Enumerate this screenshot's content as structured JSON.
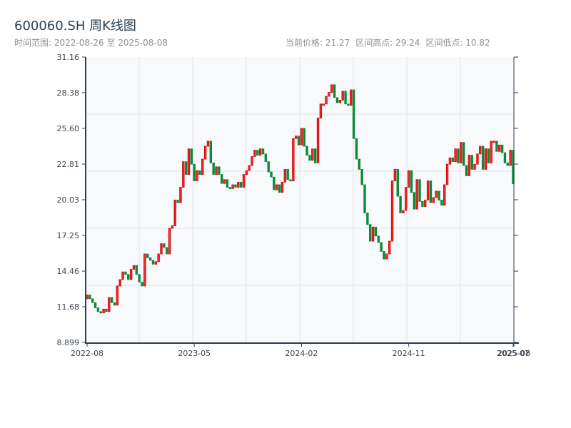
{
  "header": {
    "title": "600060.SH 周K线图",
    "range": "时间范围: 2022-08-26 至 2025-08-08",
    "current_price": "当前价格: 21.27",
    "high": "区间高点: 29.24",
    "low": "区间低点: 10.82"
  },
  "chart_data": {
    "type": "candlestick",
    "title": "600060.SH 周K线图",
    "ylim": [
      8.899,
      31.16
    ],
    "y_ticks": [
      "8.899",
      "11.68",
      "14.46",
      "17.25",
      "20.03",
      "22.81",
      "25.60",
      "28.38",
      "31.16"
    ],
    "x_ticks": [
      "2022-08",
      "2023-05",
      "2024-02",
      "2024-11",
      "2025-07",
      "2025-08"
    ],
    "x_tick_weeks": [
      0,
      39,
      78,
      117,
      155,
      156
    ],
    "grid": true,
    "colors": {
      "up": "#d40000",
      "up_fill": "#ee2a2a",
      "down": "#0a8a3a",
      "axis": "#2c3e50",
      "background": "#f7f9fb",
      "grid": "#e1e5ea"
    },
    "close": [
      12.6,
      12.3,
      12.0,
      11.6,
      11.3,
      11.2,
      11.5,
      11.3,
      12.4,
      12.0,
      11.8,
      13.3,
      13.8,
      14.4,
      14.2,
      13.8,
      14.6,
      14.9,
      14.2,
      13.6,
      13.3,
      15.8,
      15.5,
      15.3,
      15.0,
      15.2,
      15.8,
      16.6,
      16.3,
      15.8,
      17.8,
      18.0,
      20.0,
      19.8,
      21.0,
      23.0,
      22.0,
      24.0,
      22.8,
      21.5,
      22.3,
      22.0,
      23.2,
      24.2,
      24.6,
      22.9,
      22.0,
      22.6,
      22.0,
      21.3,
      21.6,
      21.0,
      20.9,
      21.2,
      21.0,
      21.4,
      21.0,
      22.0,
      22.3,
      22.7,
      23.4,
      23.9,
      23.5,
      24.0,
      23.6,
      23.0,
      22.2,
      21.8,
      20.8,
      21.2,
      20.6,
      21.4,
      22.4,
      21.6,
      21.5,
      24.8,
      25.0,
      24.3,
      25.6,
      24.2,
      23.5,
      23.1,
      24.0,
      22.9,
      26.4,
      27.5,
      27.5,
      28.1,
      28.4,
      29.0,
      28.0,
      27.6,
      27.8,
      28.5,
      27.5,
      27.4,
      28.6,
      24.8,
      23.2,
      22.4,
      21.2,
      19.0,
      18.1,
      16.8,
      17.9,
      17.2,
      16.7,
      16.0,
      15.4,
      15.8,
      16.8,
      21.5,
      22.4,
      20.3,
      19.0,
      19.2,
      21.0,
      22.3,
      20.6,
      19.3,
      21.6,
      19.9,
      19.5,
      20.0,
      21.5,
      19.8,
      20.2,
      20.7,
      20.0,
      19.6,
      21.2,
      22.8,
      23.3,
      23.0,
      24.0,
      22.9,
      24.5,
      22.7,
      21.9,
      23.5,
      22.4,
      22.8,
      23.6,
      24.2,
      22.4,
      24.0,
      22.9,
      24.6,
      24.6,
      23.8,
      24.3,
      23.7,
      22.9,
      22.7,
      23.9,
      21.27
    ],
    "open": [
      12.3,
      12.6,
      12.3,
      12.0,
      11.6,
      11.3,
      11.2,
      11.5,
      11.3,
      12.4,
      12.0,
      11.8,
      13.3,
      13.8,
      14.4,
      14.2,
      13.8,
      14.6,
      14.9,
      14.2,
      13.6,
      13.3,
      15.8,
      15.5,
      15.3,
      15.0,
      15.2,
      15.8,
      16.6,
      16.3,
      15.8,
      17.8,
      18.0,
      20.0,
      19.8,
      21.0,
      23.0,
      22.0,
      24.0,
      22.8,
      21.5,
      22.3,
      22.0,
      23.2,
      24.2,
      24.6,
      22.9,
      22.0,
      22.6,
      22.0,
      21.3,
      21.6,
      21.0,
      20.9,
      21.2,
      21.0,
      21.4,
      21.0,
      22.0,
      22.3,
      22.7,
      23.4,
      23.9,
      23.5,
      24.0,
      23.6,
      23.0,
      22.2,
      21.8,
      20.8,
      21.2,
      20.6,
      21.4,
      22.4,
      21.6,
      21.5,
      24.8,
      25.0,
      24.3,
      25.6,
      24.2,
      23.5,
      23.1,
      24.0,
      22.9,
      26.4,
      27.5,
      27.5,
      28.1,
      28.4,
      29.0,
      28.0,
      27.6,
      27.8,
      28.5,
      27.5,
      27.4,
      28.6,
      24.8,
      23.2,
      22.4,
      21.2,
      19.0,
      18.1,
      16.8,
      17.9,
      17.2,
      16.7,
      16.0,
      15.4,
      15.8,
      16.8,
      21.5,
      22.4,
      20.3,
      19.0,
      19.2,
      21.0,
      22.3,
      20.6,
      19.3,
      21.6,
      19.9,
      19.5,
      20.0,
      21.5,
      19.8,
      20.2,
      20.7,
      20.0,
      19.6,
      21.2,
      22.8,
      23.3,
      23.0,
      24.0,
      22.9,
      24.5,
      22.7,
      21.9,
      23.5,
      22.4,
      22.8,
      23.6,
      24.2,
      22.4,
      24.0,
      22.9,
      24.6,
      24.6,
      23.8,
      24.3,
      23.7,
      22.9,
      22.7,
      23.9
    ]
  }
}
